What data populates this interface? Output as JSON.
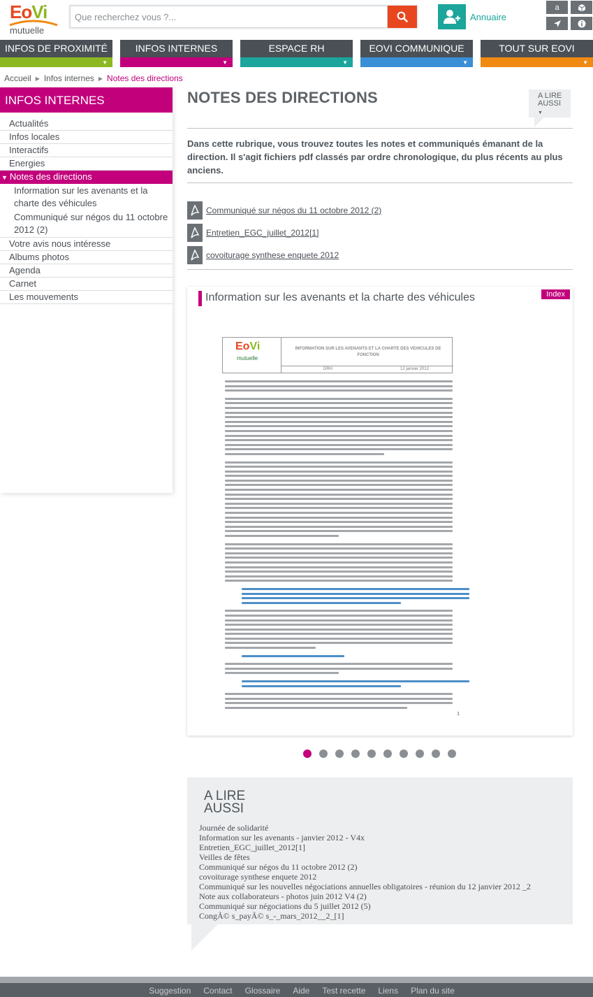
{
  "brand": {
    "name_part1": "Eo",
    "name_part2": "Vi",
    "sub": "mutuelle",
    "colors": {
      "orange": "#e8461f",
      "green": "#8cb822",
      "magenta": "#c2007c",
      "teal": "#1ba59b",
      "blue": "#3a8fd6",
      "amber": "#f08a12",
      "dark": "#4a5056"
    }
  },
  "search": {
    "placeholder": "Que recherchez vous ?...",
    "button_icon": "search-icon"
  },
  "annuaire": {
    "label": "Annuaire",
    "icon": "add-user-icon"
  },
  "tools": [
    {
      "label": "a",
      "icon": "font-size-icon"
    },
    {
      "label": "",
      "icon": "cube-icon"
    },
    {
      "label": "",
      "icon": "location-arrow-icon"
    },
    {
      "label": "",
      "icon": "info-icon"
    }
  ],
  "nav": [
    {
      "label": "INFOS DE PROXIMITÉ",
      "color": "#8cb822"
    },
    {
      "label": "INFOS INTERNES",
      "color": "#c2007c"
    },
    {
      "label": "ESPACE RH",
      "color": "#1ba59b"
    },
    {
      "label": "EOVI COMMUNIQUE",
      "color": "#3a8fd6"
    },
    {
      "label": "TOUT SUR EOVI",
      "color": "#f08a12"
    }
  ],
  "breadcrumb": [
    "Accueil",
    "Infos internes",
    "Notes des directions"
  ],
  "sidebar": {
    "title": "INFOS INTERNES",
    "items": [
      "Actualités",
      "Infos locales",
      "Interactifs",
      "Energies",
      "Notes des directions",
      "Information sur les avenants et la charte des véhicules",
      "Communiqué sur négos du 11 octobre 2012 (2)",
      "Votre avis nous intéresse",
      "Albums photos",
      "Agenda",
      "Carnet",
      "Les mouvements"
    ]
  },
  "page": {
    "title": "NOTES DES DIRECTIONS",
    "alire_tab": "A LIRE AUSSI",
    "intro": "Dans cette rubrique, vous trouvez toutes les notes et communiqués émanant de la direction. Il s'agit fichiers pdf classés par ordre chronologique, du plus récents au plus anciens."
  },
  "documents": [
    "Communiqué sur négos du 11 octobre 2012 (2)",
    "Entretien_EGC_juillet_2012[1]",
    "covoiturage synthese enquete 2012"
  ],
  "card": {
    "title": "Information sur les avenants et la charte des véhicules",
    "index_label": "Index",
    "doc_title": "INFORMATION SUR LES AVENANTS ET LA CHARTE DES VEHICULES DE FONCTION",
    "doc_dept": "DRH",
    "doc_date": "12 janvier 2012",
    "doc_page": "1",
    "pager_count": 10,
    "pager_active": 1
  },
  "alire": {
    "title_line1": "A LIRE",
    "title_line2": "AUSSI",
    "items": [
      "Journée de solidarité",
      "Information sur les avenants - janvier 2012 - V4x",
      "Entretien_EGC_juillet_2012[1]",
      "Veilles de fêtes",
      "Communiqué sur négos du 11 octobre 2012 (2)",
      "covoiturage synthese enquete 2012",
      "Communiqué sur les nouvelles négociations annuelles obligatoires - réunion du 12 janvier 2012 _2",
      "Note aux collaborateurs - photos juin 2012 V4 (2)",
      "Communiqué sur négociations du 5 juillet 2012 (5)",
      "CongÃ© s_payÃ© s_-_mars_2012__2_[1]"
    ]
  },
  "footer": [
    "Suggestion",
    "Contact",
    "Glossaire",
    "Aide",
    "Test recette",
    "Liens",
    "Plan du site"
  ]
}
